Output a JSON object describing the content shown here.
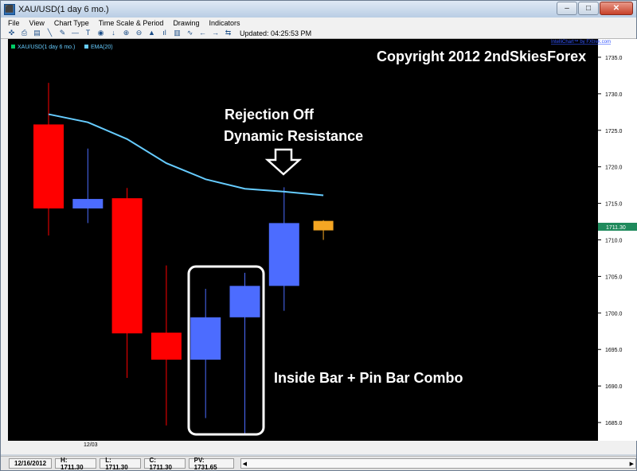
{
  "window": {
    "title": "XAU/USD(1 day  6 mo.)",
    "controls": [
      "–",
      "□",
      "✕"
    ]
  },
  "menu": [
    "File",
    "View",
    "Chart Type",
    "Time Scale & Period",
    "Drawing",
    "Indicators"
  ],
  "toolbar": {
    "icons": [
      "crosshair-icon",
      "printer-icon",
      "save-icon",
      "line-icon",
      "pen-icon",
      "hline-icon",
      "text-icon",
      "circle-icon",
      "arrow-down-icon",
      "zoom-in-icon",
      "zoom-out-icon",
      "chart-icon",
      "bars-icon",
      "candle-icon",
      "indicator-icon",
      "left-icon",
      "right-icon",
      "link-icon"
    ],
    "glyphs": [
      "✜",
      "⎙",
      "▤",
      "╲",
      "✎",
      "—",
      "T",
      "◉",
      "↓",
      "⊕",
      "⊖",
      "▲",
      "ıl",
      "▥",
      "∿",
      "←",
      "→",
      "⇆"
    ],
    "updated_text": "Updated: 04:25:53 PM"
  },
  "legend": {
    "symbol": "XAU/USD(1 day  6 mo.)",
    "ema": "EMA(20)"
  },
  "watermark": "IntelliChart™ by FXtrek.com",
  "annotations": {
    "copyright": "Copyright 2012 2ndSkiesForex",
    "rejection_line1": "Rejection Off",
    "rejection_line2": "Dynamic Resistance",
    "combo": "Inside Bar + Pin Bar Combo"
  },
  "x_axis_label": "12/03",
  "last_price_tag": "1711.30",
  "colors": {
    "background": "#000000",
    "bear": "#ff0000",
    "bull": "#4c6cff",
    "last": "#f5a623",
    "ema": "#66ccff",
    "price_tag": "#1f8a5c"
  },
  "status": {
    "date": "12/16/2012",
    "high": "H: 1711.30",
    "low": "L: 1711.30",
    "close": "C: 1711.30",
    "pv": "PV: 1731.65"
  },
  "chart_data": {
    "type": "candlestick",
    "y_axis": {
      "min": 1682.5,
      "max": 1737.5,
      "ticks": [
        1685.0,
        1690.0,
        1695.0,
        1700.0,
        1705.0,
        1710.0,
        1715.0,
        1720.0,
        1725.0,
        1730.0,
        1735.0
      ]
    },
    "candles": [
      {
        "open": 1725.8,
        "high": 1731.5,
        "low": 1710.6,
        "close": 1714.3,
        "color": "bear"
      },
      {
        "open": 1714.3,
        "high": 1722.5,
        "low": 1712.3,
        "close": 1715.6,
        "color": "bull"
      },
      {
        "open": 1715.7,
        "high": 1717.1,
        "low": 1691.1,
        "close": 1697.2,
        "color": "bear"
      },
      {
        "open": 1697.3,
        "high": 1706.5,
        "low": 1684.6,
        "close": 1693.6,
        "color": "bear"
      },
      {
        "open": 1693.6,
        "high": 1703.3,
        "low": 1685.6,
        "close": 1699.4,
        "color": "bull"
      },
      {
        "open": 1699.4,
        "high": 1705.5,
        "low": 1683.5,
        "close": 1703.7,
        "color": "bull"
      },
      {
        "open": 1703.7,
        "high": 1717.2,
        "low": 1700.3,
        "close": 1712.3,
        "color": "bull"
      },
      {
        "open": 1711.3,
        "high": 1712.7,
        "low": 1710.0,
        "close": 1712.6,
        "color": "last"
      }
    ],
    "ema": [
      1727.2,
      1726.1,
      1723.8,
      1720.5,
      1718.3,
      1717.0,
      1716.6,
      1716.1
    ]
  }
}
